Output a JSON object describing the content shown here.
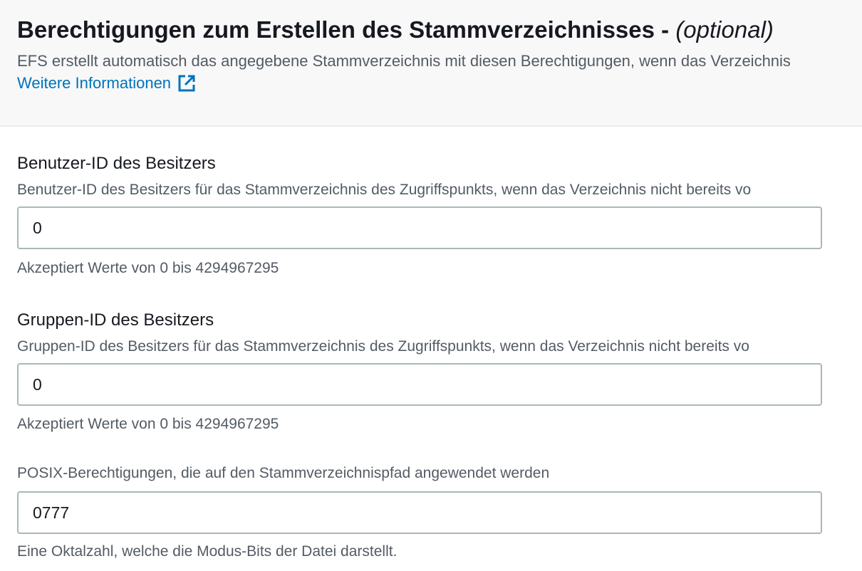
{
  "header": {
    "title": "Berechtigungen zum Erstellen des Stammverzeichnisses - ",
    "title_optional": "(optional)",
    "description": "EFS erstellt automatisch das angegebene Stammverzeichnis mit diesen Berechtigungen, wenn das Verzeichnis",
    "info_link": "Weitere Informationen",
    "info_link_icon": "external-link-icon",
    "link_color": "#0073bb"
  },
  "owner_uid": {
    "label": "Benutzer-ID des Besitzers",
    "description": "Benutzer-ID des Besitzers für das Stammverzeichnis des Zugriffspunkts, wenn das Verzeichnis nicht bereits vo",
    "value": "0",
    "constraint": "Akzeptiert Werte von 0 bis 4294967295"
  },
  "owner_gid": {
    "label": "Gruppen-ID des Besitzers",
    "description": "Gruppen-ID des Besitzers für das Stammverzeichnis des Zugriffspunkts, wenn das Verzeichnis nicht bereits vo",
    "value": "0",
    "constraint": "Akzeptiert Werte von 0 bis 4294967295"
  },
  "posix": {
    "description": "POSIX-Berechtigungen, die auf den Stammverzeichnispfad angewendet werden",
    "value": "0777",
    "constraint": "Eine Oktalzahl, welche die Modus-Bits der Datei darstellt."
  }
}
